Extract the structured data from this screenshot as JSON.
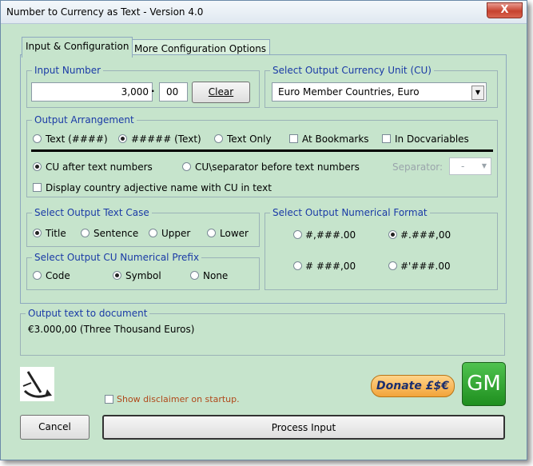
{
  "window": {
    "title": "Number to Currency as Text - Version 4.0",
    "close_glyph": "X"
  },
  "tabs": [
    {
      "label": "Input & Configuration"
    },
    {
      "label": "More Configuration Options"
    }
  ],
  "input_number": {
    "legend": "Input Number",
    "value": "3,000",
    "separator": "·",
    "decimals": "00",
    "clear_label": "Clear"
  },
  "currency": {
    "legend": "Select Output Currency Unit (CU)",
    "selected": "Euro Member Countries, Euro"
  },
  "arrangement": {
    "legend": "Output Arrangement",
    "options": [
      "Text (####)",
      "##### (Text)",
      "Text Only"
    ],
    "selected_index": 1,
    "checks": [
      "At Bookmarks",
      "In Docvariables"
    ],
    "cu_options": [
      "CU after text numbers",
      "CU\\separator before text numbers"
    ],
    "cu_selected_index": 0,
    "separator_label": "Separator:",
    "separator_value": "-",
    "adjective_label": "Display country adjective name with CU in text"
  },
  "text_case": {
    "legend": "Select Output Text Case",
    "options": [
      "Title",
      "Sentence",
      "Upper",
      "Lower"
    ],
    "selected_index": 0
  },
  "prefix": {
    "legend": "Select Output CU Numerical Prefix",
    "options": [
      "Code",
      "Symbol",
      "None"
    ],
    "selected_index": 1
  },
  "num_format": {
    "legend": "Select Output Numerical Format",
    "options": [
      "#,###.00",
      "#.###,00",
      "# ###,00",
      "#'###.00"
    ],
    "selected_index": 1
  },
  "output": {
    "legend": "Output text to document",
    "text": "€3.000,00 (Three Thousand Euros)"
  },
  "footer": {
    "disclaimer_label": "Show disclaimer on startup.",
    "donate_label": "Donate £$€",
    "gm_label": "GM",
    "cancel_label": "Cancel",
    "process_label": "Process Input"
  },
  "colors": {
    "legend": "#1a3aa6",
    "background": "#c6e4cc",
    "disclaimer": "#b0481a",
    "gm": "#1f8f1f",
    "donate": "#f2a43a"
  }
}
